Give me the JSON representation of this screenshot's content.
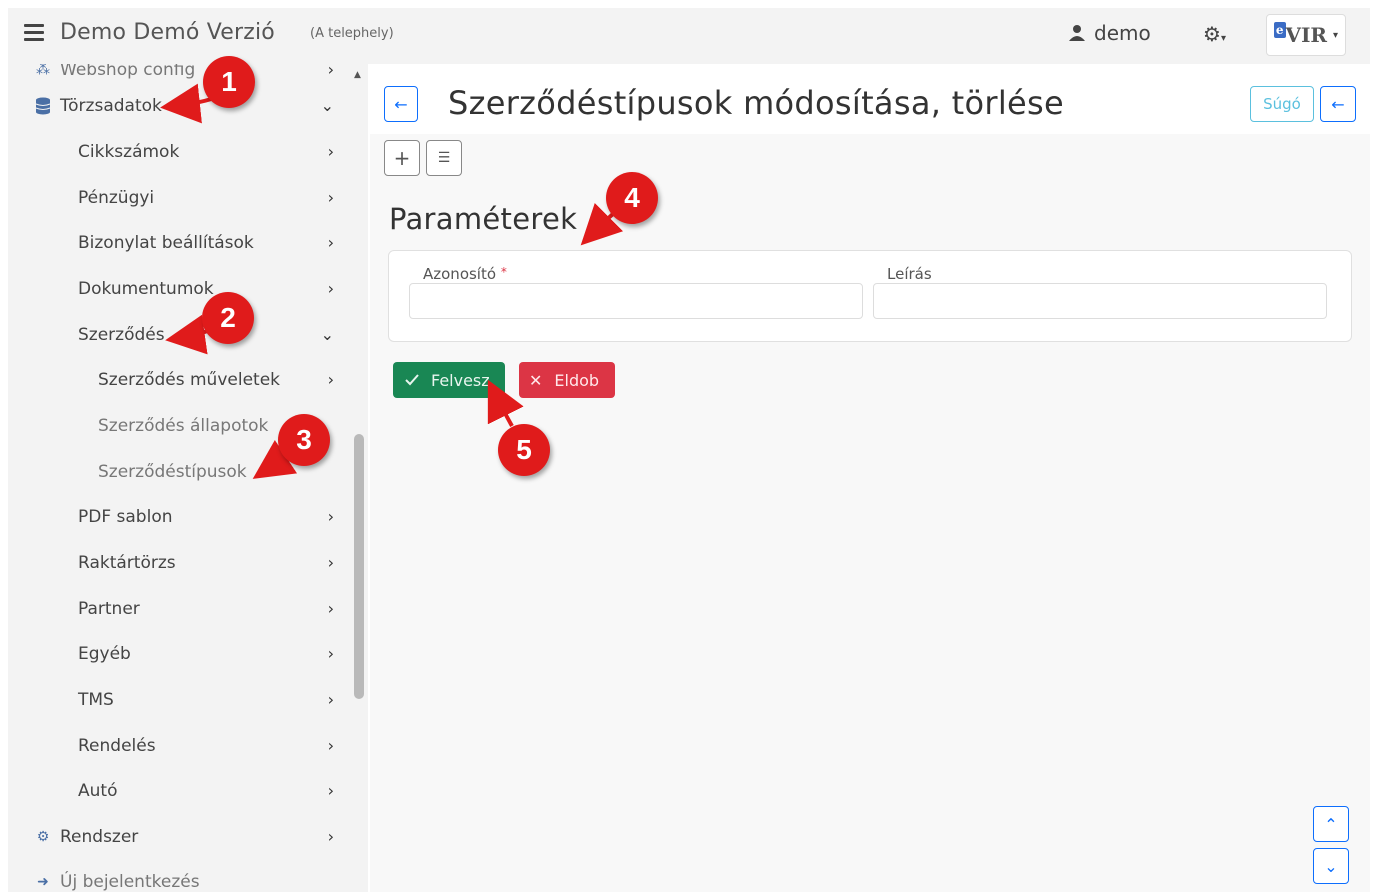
{
  "header": {
    "app_title": "Demo Demó Verzió",
    "site": "(A telephely)",
    "user": "demo",
    "brand": "VIR",
    "brand_prefix": "e"
  },
  "sidebar": {
    "cut_off_item": "Webshop config",
    "items": [
      {
        "label": "Törzsadatok",
        "level": 0,
        "chevron": "down"
      },
      {
        "label": "Cikkszámok",
        "level": 1,
        "chevron": "right"
      },
      {
        "label": "Pénzügyi",
        "level": 1,
        "chevron": "right"
      },
      {
        "label": "Bizonylat beállítások",
        "level": 1,
        "chevron": "right"
      },
      {
        "label": "Dokumentumok",
        "level": 1,
        "chevron": "right"
      },
      {
        "label": "Szerződés",
        "level": 1,
        "chevron": "down"
      },
      {
        "label": "Szerződés műveletek",
        "level": 2,
        "chevron": "right"
      },
      {
        "label": "Szerződés állapotok",
        "level": 2,
        "chevron": ""
      },
      {
        "label": "Szerződéstípusok",
        "level": 2,
        "chevron": ""
      },
      {
        "label": "PDF sablon",
        "level": 1,
        "chevron": "right"
      },
      {
        "label": "Raktártörzs",
        "level": 1,
        "chevron": "right"
      },
      {
        "label": "Partner",
        "level": 1,
        "chevron": "right"
      },
      {
        "label": "Egyéb",
        "level": 1,
        "chevron": "right"
      },
      {
        "label": "TMS",
        "level": 1,
        "chevron": "right"
      },
      {
        "label": "Rendelés",
        "level": 1,
        "chevron": "right"
      },
      {
        "label": "Autó",
        "level": 1,
        "chevron": "right"
      },
      {
        "label": "Rendszer",
        "level": 0,
        "chevron": "right"
      },
      {
        "label": "Új bejelentkezés",
        "level": 0,
        "chevron": ""
      }
    ]
  },
  "main": {
    "page_title": "Szerződéstípusok módosítása, törlése",
    "help_label": "Súgó",
    "section_title": "Paraméterek",
    "fields": {
      "id_label": "Azonosító",
      "id_required": "*",
      "id_value": "",
      "desc_label": "Leírás",
      "desc_value": ""
    },
    "save_label": "Felvesz",
    "discard_label": "Eldob"
  },
  "callouts": [
    "1",
    "2",
    "3",
    "4",
    "5"
  ],
  "colors": {
    "primary": "#0d6efd",
    "success": "#198754",
    "danger": "#dc3545",
    "info": "#5bc0de",
    "callout": "#e01b1b"
  }
}
